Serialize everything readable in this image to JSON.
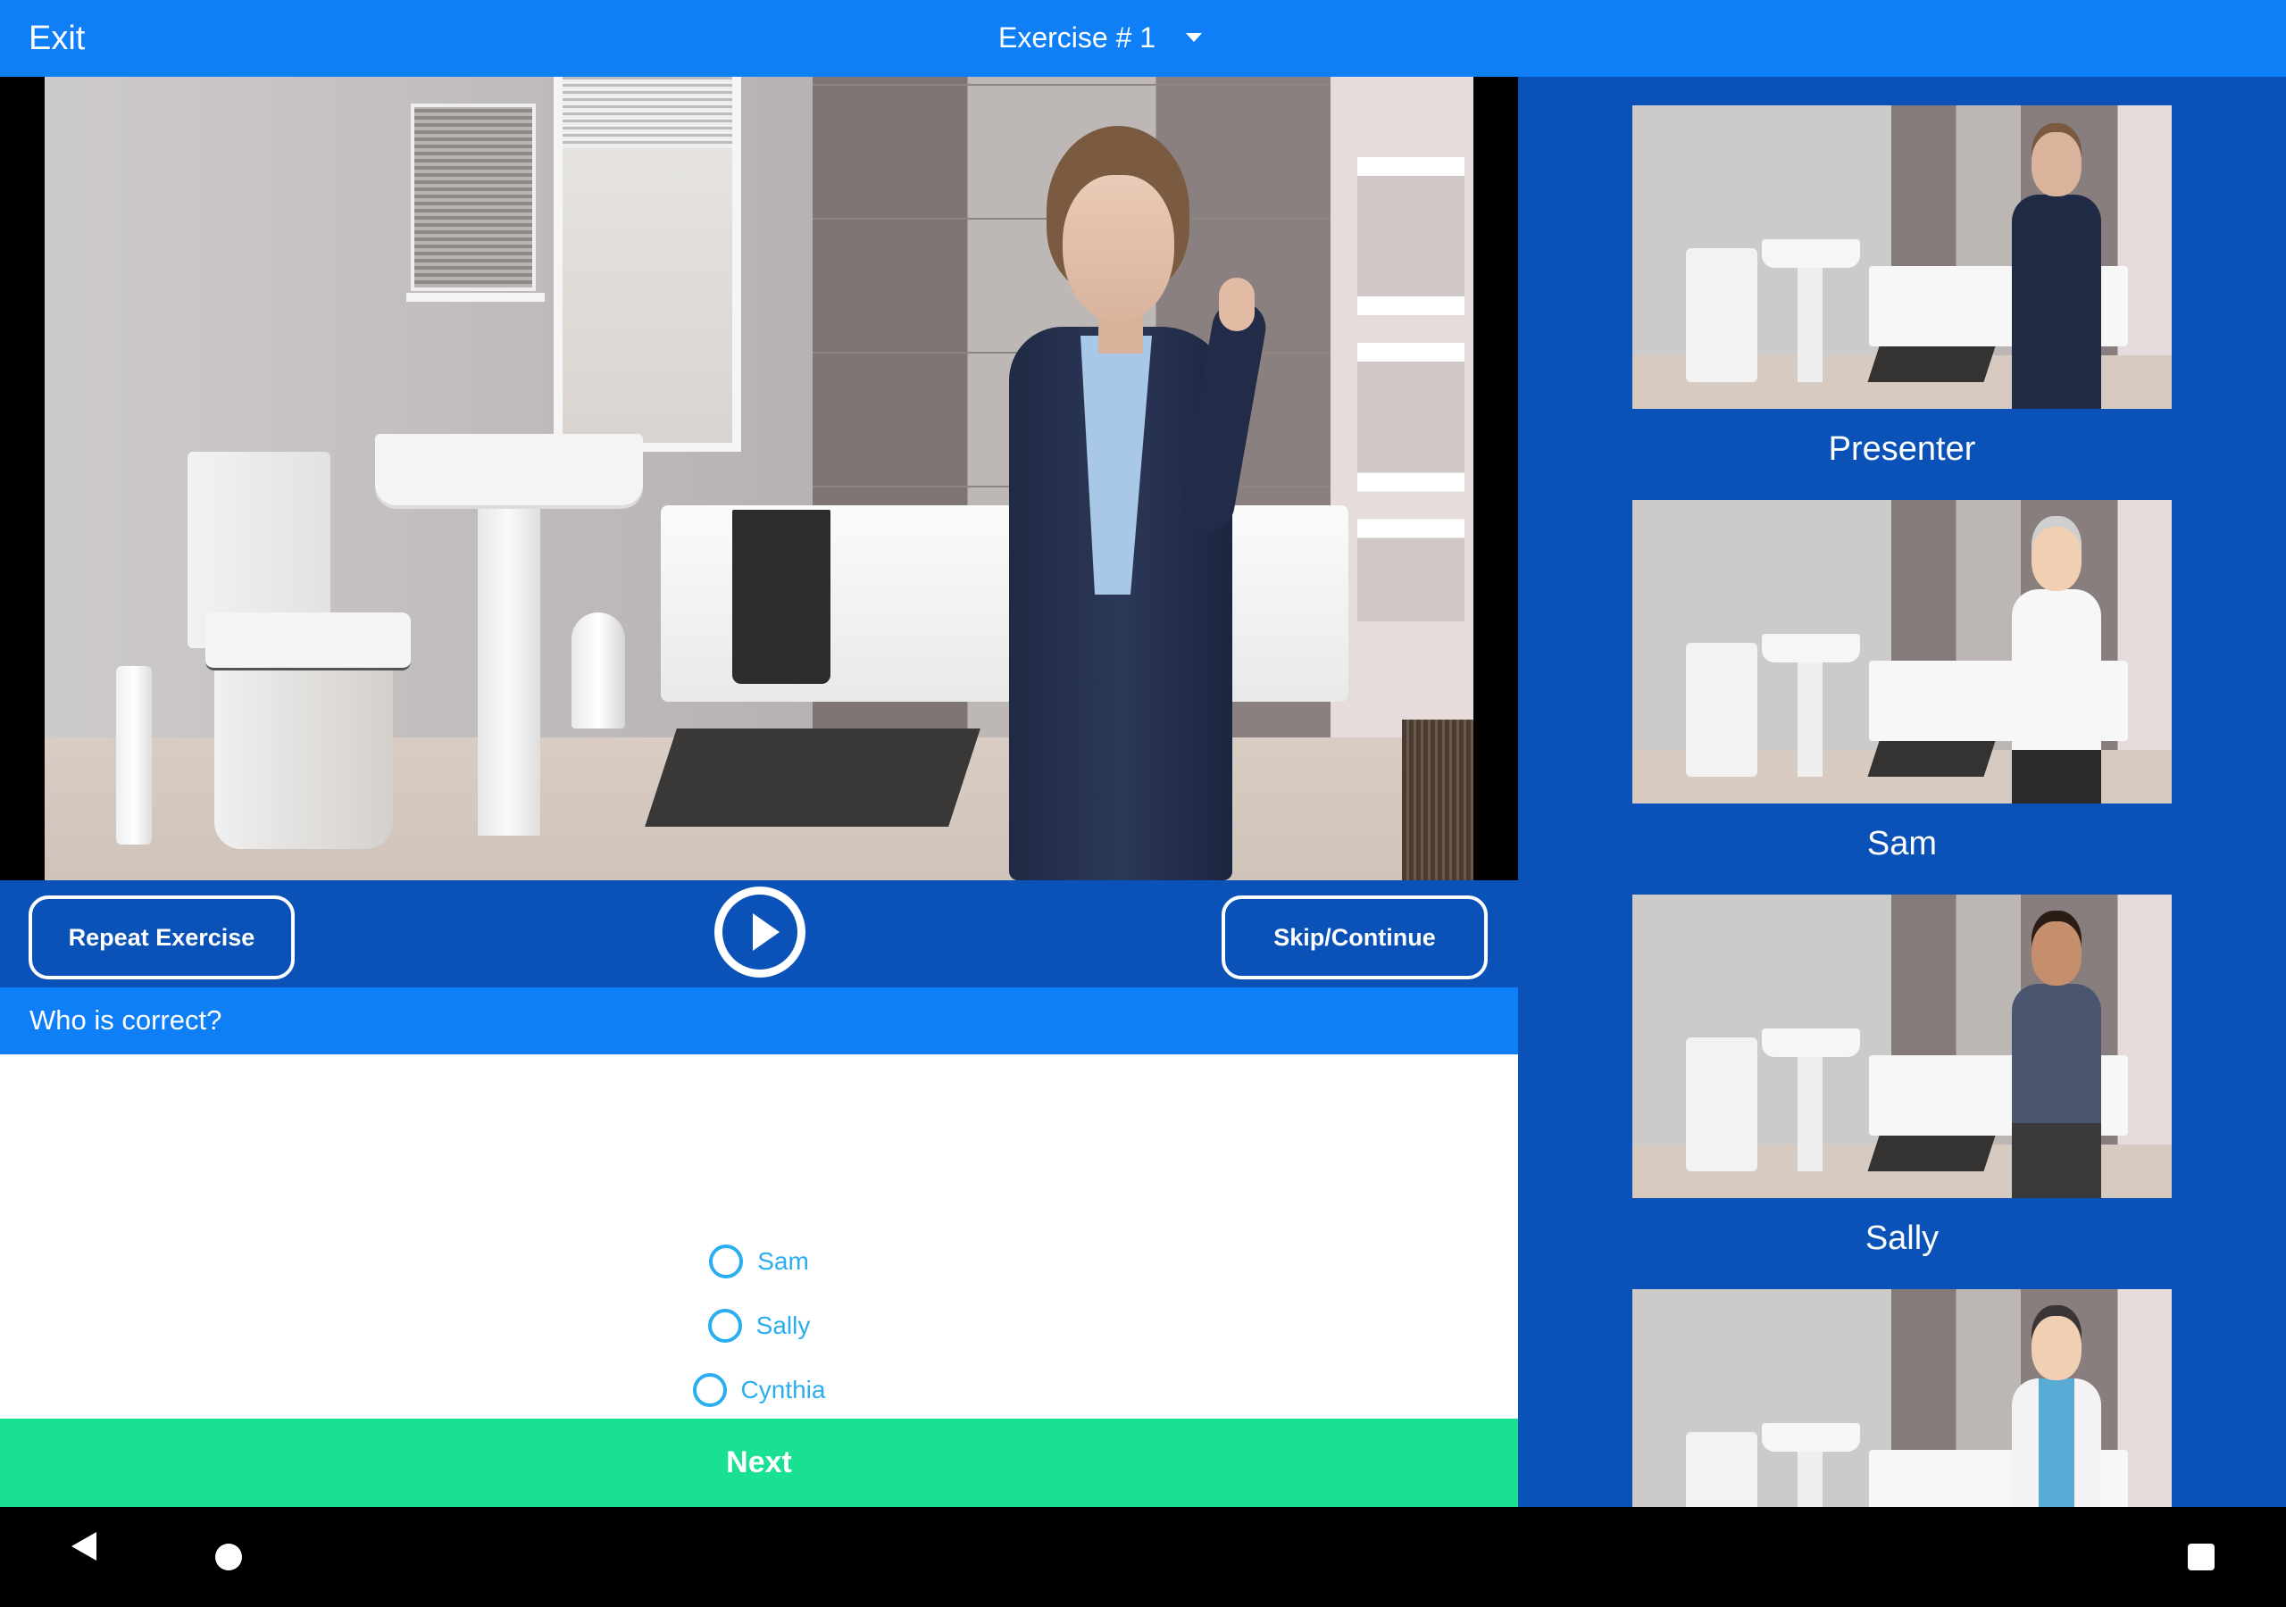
{
  "topbar": {
    "exit_label": "Exit",
    "exercise_title": "Exercise # 1",
    "dropdown_icon": "caret-down-icon"
  },
  "colors": {
    "topbar": "#0e7ff7",
    "panel": "#0a52b8",
    "next": "#19e093",
    "radio": "#2aaef0"
  },
  "video": {
    "scene": "bathroom",
    "speaker": "Presenter"
  },
  "controls": {
    "repeat_label": "Repeat Exercise",
    "play_icon": "play-circle-icon",
    "skip_label": "Skip/Continue"
  },
  "question": {
    "text": "Who is correct?",
    "options": [
      {
        "label": "Sam",
        "selected": false
      },
      {
        "label": "Sally",
        "selected": false
      },
      {
        "label": "Cynthia",
        "selected": false
      }
    ]
  },
  "next_label": "Next",
  "characters": [
    {
      "name": "Presenter"
    },
    {
      "name": "Sam"
    },
    {
      "name": "Sally"
    },
    {
      "name": ""
    }
  ],
  "navbar": {
    "back_icon": "back-triangle-icon",
    "home_icon": "home-circle-icon",
    "recents_icon": "recents-square-icon"
  }
}
